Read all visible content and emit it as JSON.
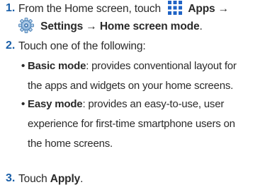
{
  "steps": [
    {
      "number": "1.",
      "line1_prefix": "From the Home screen, touch",
      "apps_label": "Apps",
      "arrow1": "→",
      "settings_label": "Settings",
      "arrow2": "→",
      "home_screen_mode_label": "Home screen mode",
      "end_period": ".",
      "icons": [
        "apps-grid-icon",
        "settings-gear-icon"
      ]
    },
    {
      "number": "2.",
      "text": "Touch one of the following:",
      "options": [
        {
          "bullet": "•",
          "title": "Basic mode",
          "line1": ": provides conventional layout for",
          "line2": "the apps and widgets on your home screens."
        },
        {
          "bullet": "•",
          "title": "Easy mode",
          "line1": ": provides an easy-to-use, user",
          "line2": "experience for first-time smartphone users on",
          "line3": "the home screens."
        }
      ]
    },
    {
      "number": "3.",
      "text_prefix": "Touch",
      "apply_label": "Apply",
      "end_period": "."
    }
  ],
  "colors": {
    "step_number": "#1a5fa8",
    "apps_icon": "#1f63c5",
    "text": "#2a2a2a"
  }
}
